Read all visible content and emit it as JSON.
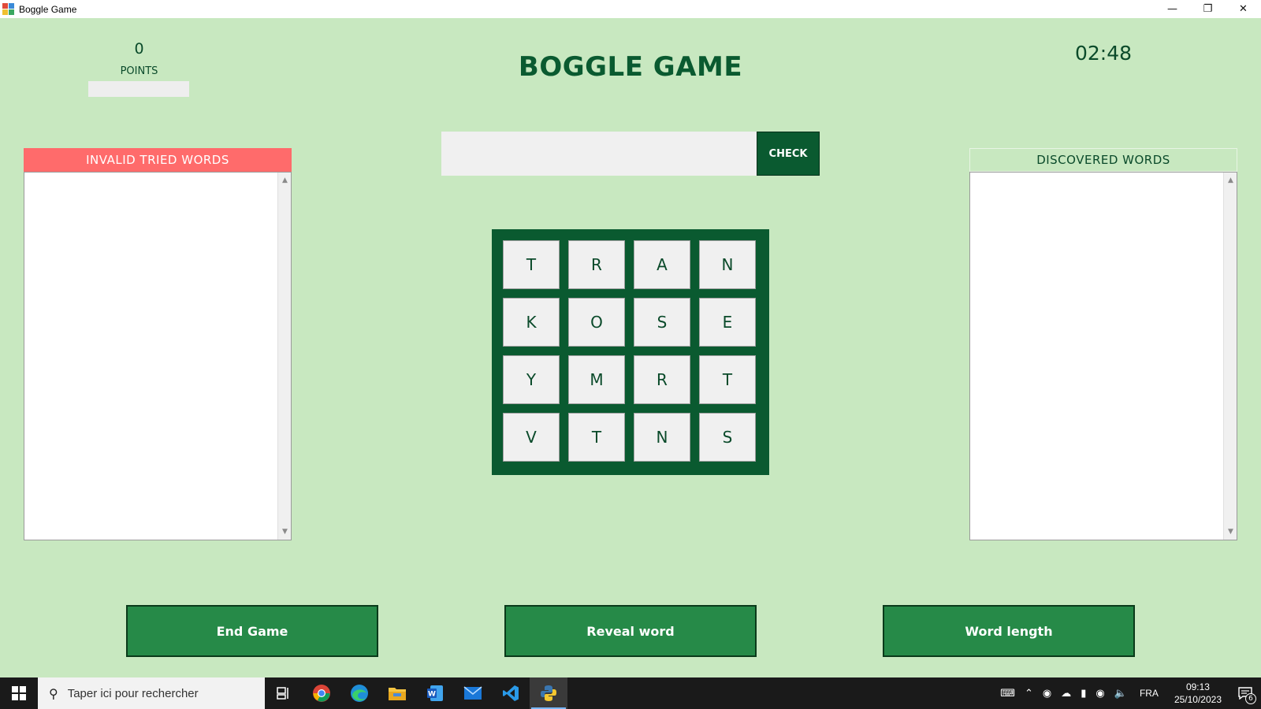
{
  "window": {
    "title": "Boggle Game",
    "minimize_icon": "minimize-icon",
    "restore_icon": "restore-icon",
    "close_icon": "close-icon"
  },
  "score": {
    "value": "0",
    "label": "POINTS"
  },
  "game_title": "BOGGLE GAME",
  "timer": "02:48",
  "word_entry": {
    "value": "",
    "check_label": "CHECK"
  },
  "invalid_panel": {
    "title": "INVALID TRIED WORDS",
    "items": []
  },
  "discovered_panel": {
    "title": "DISCOVERED WORDS",
    "items": []
  },
  "board": {
    "rows": [
      [
        "T",
        "R",
        "A",
        "N"
      ],
      [
        "K",
        "O",
        "S",
        "E"
      ],
      [
        "Y",
        "M",
        "R",
        "T"
      ],
      [
        "V",
        "T",
        "N",
        "S"
      ]
    ]
  },
  "actions": {
    "end_game": "End Game",
    "reveal_word": "Reveal word",
    "word_length": "Word length"
  },
  "taskbar": {
    "search_placeholder": "Taper ici pour rechercher",
    "apps": [
      "task-view-icon",
      "chrome-icon",
      "edge-icon",
      "file-explorer-icon",
      "word-icon",
      "mail-icon",
      "vscode-icon",
      "python-icon"
    ],
    "language": "FRA",
    "time": "09:13",
    "date": "25/10/2023",
    "notification_count": "6"
  },
  "colors": {
    "background": "#c8e8c0",
    "dark_green": "#0a5a30",
    "button_green": "#268a48",
    "invalid_header": "#ff6b6b"
  }
}
